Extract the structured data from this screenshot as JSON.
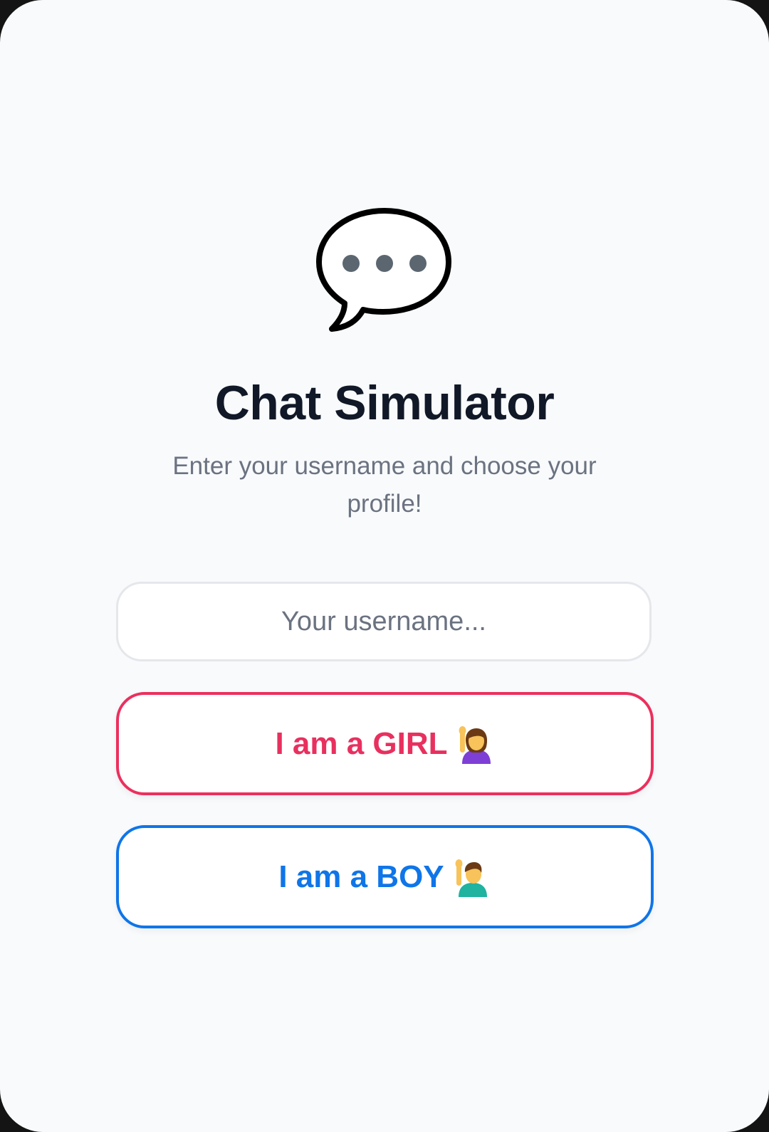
{
  "app": {
    "title": "Chat Simulator",
    "subtitle": "Enter your username and choose your profile!"
  },
  "username": {
    "placeholder": "Your username...",
    "value": ""
  },
  "buttons": {
    "girl_label": "I am a GIRL",
    "boy_label": "I am a BOY"
  },
  "icons": {
    "hero": "speech-bubble-icon",
    "girl": "woman-raising-hand-icon",
    "boy": "man-raising-hand-icon"
  },
  "colors": {
    "background": "#f8fafc",
    "title": "#111827",
    "subtitle": "#6b7280",
    "girl_accent": "#e8305f",
    "boy_accent": "#0f75e8",
    "input_border": "#e5e7eb"
  }
}
